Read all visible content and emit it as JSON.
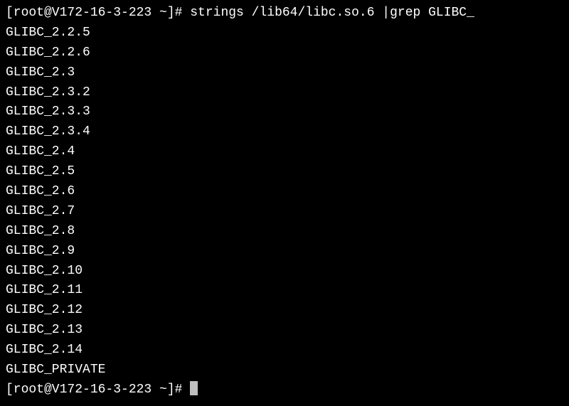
{
  "terminal": {
    "prompt1": {
      "prefix": "[root@V172-16-3-223 ~]# ",
      "command": "strings /lib64/libc.so.6 |grep GLIBC_"
    },
    "output": [
      "GLIBC_2.2.5",
      "GLIBC_2.2.6",
      "GLIBC_2.3",
      "GLIBC_2.3.2",
      "GLIBC_2.3.3",
      "GLIBC_2.3.4",
      "GLIBC_2.4",
      "GLIBC_2.5",
      "GLIBC_2.6",
      "GLIBC_2.7",
      "GLIBC_2.8",
      "GLIBC_2.9",
      "GLIBC_2.10",
      "GLIBC_2.11",
      "GLIBC_2.12",
      "GLIBC_2.13",
      "GLIBC_2.14",
      "GLIBC_PRIVATE"
    ],
    "prompt2": {
      "prefix": "[root@V172-16-3-223 ~]# "
    }
  }
}
